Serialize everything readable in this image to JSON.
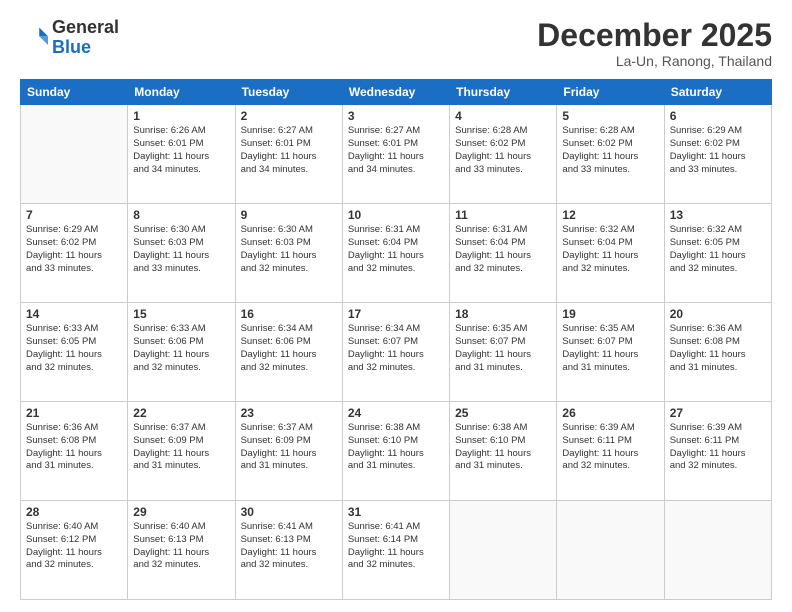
{
  "header": {
    "logo": {
      "general": "General",
      "blue": "Blue"
    },
    "title": "December 2025",
    "subtitle": "La-Un, Ranong, Thailand"
  },
  "calendar": {
    "days_of_week": [
      "Sunday",
      "Monday",
      "Tuesday",
      "Wednesday",
      "Thursday",
      "Friday",
      "Saturday"
    ],
    "weeks": [
      [
        {
          "day": "",
          "info": ""
        },
        {
          "day": "1",
          "info": "Sunrise: 6:26 AM\nSunset: 6:01 PM\nDaylight: 11 hours\nand 34 minutes."
        },
        {
          "day": "2",
          "info": "Sunrise: 6:27 AM\nSunset: 6:01 PM\nDaylight: 11 hours\nand 34 minutes."
        },
        {
          "day": "3",
          "info": "Sunrise: 6:27 AM\nSunset: 6:01 PM\nDaylight: 11 hours\nand 34 minutes."
        },
        {
          "day": "4",
          "info": "Sunrise: 6:28 AM\nSunset: 6:02 PM\nDaylight: 11 hours\nand 33 minutes."
        },
        {
          "day": "5",
          "info": "Sunrise: 6:28 AM\nSunset: 6:02 PM\nDaylight: 11 hours\nand 33 minutes."
        },
        {
          "day": "6",
          "info": "Sunrise: 6:29 AM\nSunset: 6:02 PM\nDaylight: 11 hours\nand 33 minutes."
        }
      ],
      [
        {
          "day": "7",
          "info": "Sunrise: 6:29 AM\nSunset: 6:02 PM\nDaylight: 11 hours\nand 33 minutes."
        },
        {
          "day": "8",
          "info": "Sunrise: 6:30 AM\nSunset: 6:03 PM\nDaylight: 11 hours\nand 33 minutes."
        },
        {
          "day": "9",
          "info": "Sunrise: 6:30 AM\nSunset: 6:03 PM\nDaylight: 11 hours\nand 32 minutes."
        },
        {
          "day": "10",
          "info": "Sunrise: 6:31 AM\nSunset: 6:04 PM\nDaylight: 11 hours\nand 32 minutes."
        },
        {
          "day": "11",
          "info": "Sunrise: 6:31 AM\nSunset: 6:04 PM\nDaylight: 11 hours\nand 32 minutes."
        },
        {
          "day": "12",
          "info": "Sunrise: 6:32 AM\nSunset: 6:04 PM\nDaylight: 11 hours\nand 32 minutes."
        },
        {
          "day": "13",
          "info": "Sunrise: 6:32 AM\nSunset: 6:05 PM\nDaylight: 11 hours\nand 32 minutes."
        }
      ],
      [
        {
          "day": "14",
          "info": "Sunrise: 6:33 AM\nSunset: 6:05 PM\nDaylight: 11 hours\nand 32 minutes."
        },
        {
          "day": "15",
          "info": "Sunrise: 6:33 AM\nSunset: 6:06 PM\nDaylight: 11 hours\nand 32 minutes."
        },
        {
          "day": "16",
          "info": "Sunrise: 6:34 AM\nSunset: 6:06 PM\nDaylight: 11 hours\nand 32 minutes."
        },
        {
          "day": "17",
          "info": "Sunrise: 6:34 AM\nSunset: 6:07 PM\nDaylight: 11 hours\nand 32 minutes."
        },
        {
          "day": "18",
          "info": "Sunrise: 6:35 AM\nSunset: 6:07 PM\nDaylight: 11 hours\nand 31 minutes."
        },
        {
          "day": "19",
          "info": "Sunrise: 6:35 AM\nSunset: 6:07 PM\nDaylight: 11 hours\nand 31 minutes."
        },
        {
          "day": "20",
          "info": "Sunrise: 6:36 AM\nSunset: 6:08 PM\nDaylight: 11 hours\nand 31 minutes."
        }
      ],
      [
        {
          "day": "21",
          "info": "Sunrise: 6:36 AM\nSunset: 6:08 PM\nDaylight: 11 hours\nand 31 minutes."
        },
        {
          "day": "22",
          "info": "Sunrise: 6:37 AM\nSunset: 6:09 PM\nDaylight: 11 hours\nand 31 minutes."
        },
        {
          "day": "23",
          "info": "Sunrise: 6:37 AM\nSunset: 6:09 PM\nDaylight: 11 hours\nand 31 minutes."
        },
        {
          "day": "24",
          "info": "Sunrise: 6:38 AM\nSunset: 6:10 PM\nDaylight: 11 hours\nand 31 minutes."
        },
        {
          "day": "25",
          "info": "Sunrise: 6:38 AM\nSunset: 6:10 PM\nDaylight: 11 hours\nand 31 minutes."
        },
        {
          "day": "26",
          "info": "Sunrise: 6:39 AM\nSunset: 6:11 PM\nDaylight: 11 hours\nand 32 minutes."
        },
        {
          "day": "27",
          "info": "Sunrise: 6:39 AM\nSunset: 6:11 PM\nDaylight: 11 hours\nand 32 minutes."
        }
      ],
      [
        {
          "day": "28",
          "info": "Sunrise: 6:40 AM\nSunset: 6:12 PM\nDaylight: 11 hours\nand 32 minutes."
        },
        {
          "day": "29",
          "info": "Sunrise: 6:40 AM\nSunset: 6:13 PM\nDaylight: 11 hours\nand 32 minutes."
        },
        {
          "day": "30",
          "info": "Sunrise: 6:41 AM\nSunset: 6:13 PM\nDaylight: 11 hours\nand 32 minutes."
        },
        {
          "day": "31",
          "info": "Sunrise: 6:41 AM\nSunset: 6:14 PM\nDaylight: 11 hours\nand 32 minutes."
        },
        {
          "day": "",
          "info": ""
        },
        {
          "day": "",
          "info": ""
        },
        {
          "day": "",
          "info": ""
        }
      ]
    ]
  }
}
